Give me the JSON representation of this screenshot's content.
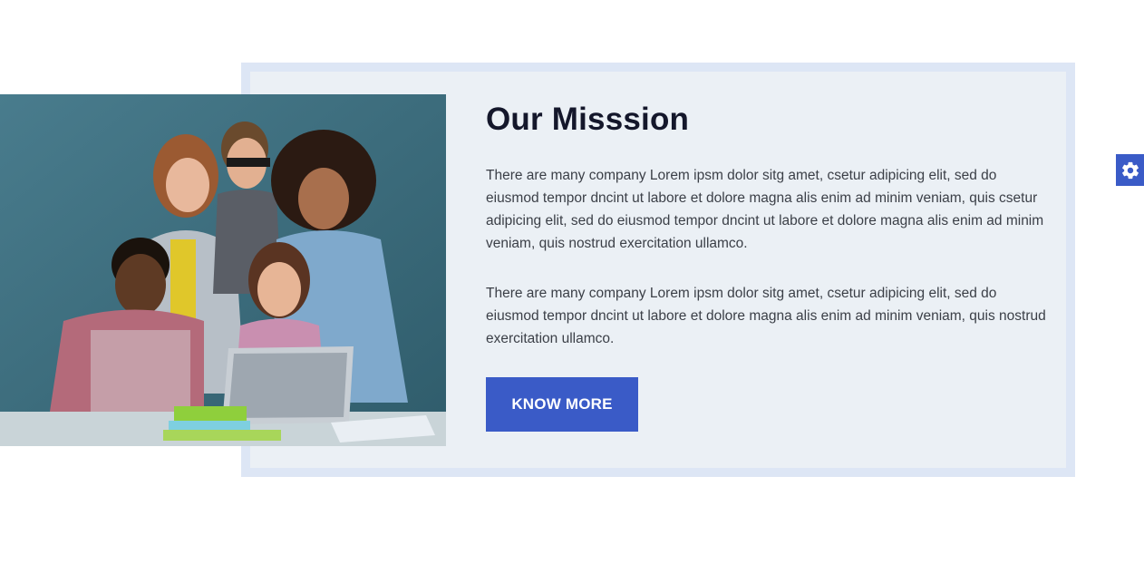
{
  "mission": {
    "title": "Our Misssion",
    "paragraph_1": "There are many company Lorem ipsm dolor sitg amet, csetur adipicing elit, sed do eiusmod tempor dncint ut labore et dolore magna alis enim ad minim veniam, quis csetur adipicing elit, sed do eiusmod tempor dncint ut labore et dolore magna alis enim ad minim veniam, quis nostrud exercitation ullamco.",
    "paragraph_2": "There are many company Lorem ipsm dolor sitg amet, csetur adipicing elit, sed do eiusmod tempor dncint ut labore et dolore magna alis enim ad minim veniam, quis nostrud exercitation ullamco.",
    "button_label": "KNOW MORE",
    "image_icon": "team-photo"
  },
  "settings": {
    "icon": "gear-icon"
  },
  "colors": {
    "accent": "#3a5bc7",
    "frame": "#dde6f5",
    "panel": "#ebf0f5",
    "heading": "#14172b",
    "text": "#3b3f47"
  }
}
